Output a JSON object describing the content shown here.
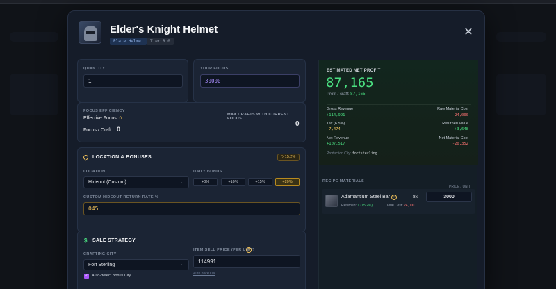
{
  "modal": {
    "title": "Elder's Knight Helmet",
    "badge_type": "Plate Helmet",
    "badge_tier": "Tier 8.0",
    "close_glyph": "✕"
  },
  "quantity": {
    "label": "QUANTITY",
    "value": "1"
  },
  "focus": {
    "label": "YOUR FOCUS",
    "value": "30000"
  },
  "focus_efficiency": {
    "label": "FOCUS EFFICIENCY",
    "effective_label": "Effective Focus:",
    "effective_value": "0",
    "per_craft_label": "Focus / Craft:",
    "per_craft_value": "0",
    "max_label": "MAX CRAFTS WITH CURRENT FOCUS",
    "max_value": "0"
  },
  "location": {
    "title": "LOCATION & BONUSES",
    "badge_value": "15.2%",
    "location_label": "LOCATION",
    "location_value": "Hideout (Custom)",
    "daily_label": "DAILY BONUS",
    "daily_options": [
      "+0%",
      "+10%",
      "+15%",
      "+20%"
    ],
    "daily_selected": 3,
    "rate_label": "CUSTOM HIDEOUT RETURN RATE %",
    "rate_value": "045"
  },
  "sale": {
    "title": "SALE STRATEGY",
    "city_label": "CRAFTING CITY",
    "city_value": "Fort Sterling",
    "autodetect_label": "Auto-detect Bonus City",
    "price_label": "ITEM SELL PRICE (PER UNIT)",
    "price_value": "114991",
    "auto_price_link": "Auto price ON"
  },
  "profit": {
    "header": "ESTIMATED NET PROFIT",
    "net_profit": "87,165",
    "per_craft_label": "Profit / craft:",
    "per_craft_value": "87,165",
    "gross_label": "Gross Revenue",
    "gross_value": "+114,991",
    "raw_label": "Raw Material Cost",
    "raw_value": "-24,000",
    "tax_label": "Tax (6.5%)",
    "tax_value": "-7,474",
    "returned_label": "Returned Value",
    "returned_value": "+3,648",
    "net_rev_label": "Net Revenue",
    "net_rev_value": "+107,517",
    "net_mat_label": "Net Material Cost",
    "net_mat_value": "-20,352",
    "city_label": "Production City:",
    "city_value": "fortsterling"
  },
  "recipe": {
    "header": "RECIPE MATERIALS",
    "material_name": "Adamantium Steel Bar",
    "material_count": "8x",
    "returned_label": "Returned:",
    "returned_value": "1 (15.2%)",
    "total_label": "Total Cost:",
    "total_value": "24,000",
    "price_unit_label": "PRICE / UNIT",
    "price_unit_value": "3000"
  },
  "colors": {
    "accent_green": "#4ade80",
    "accent_gold": "#f1c25b",
    "negative_red": "#f87171",
    "focus_purple": "#a78bfa"
  }
}
